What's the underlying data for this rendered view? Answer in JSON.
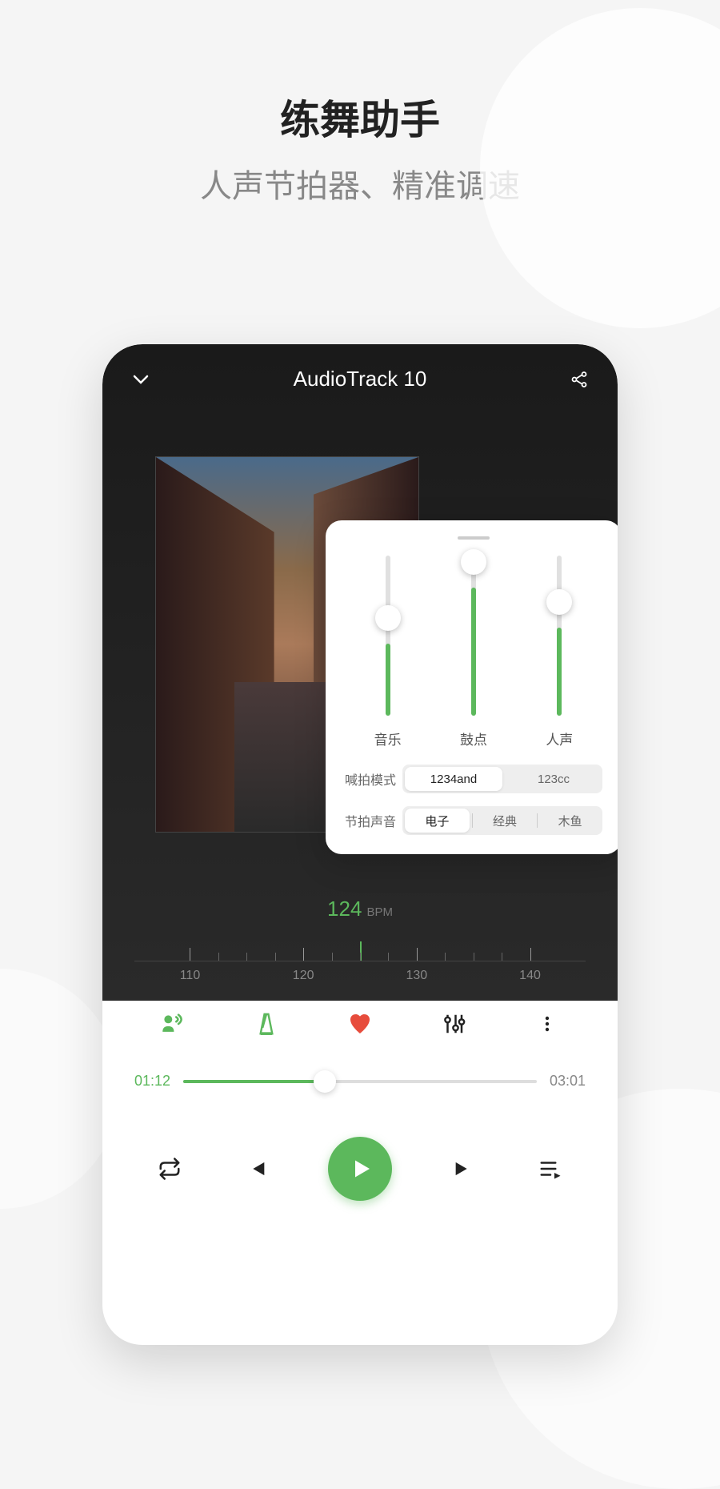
{
  "hero": {
    "title": "练舞助手",
    "subtitle": "人声节拍器、精准调速"
  },
  "header": {
    "track_title": "AudioTrack 10"
  },
  "bpm": {
    "value": "124",
    "unit": "BPM"
  },
  "ruler": {
    "ticks": [
      "110",
      "120",
      "130",
      "140"
    ]
  },
  "panel": {
    "sliders": [
      {
        "label": "音乐",
        "pct": 45
      },
      {
        "label": "鼓点",
        "pct": 80
      },
      {
        "label": "人声",
        "pct": 55
      }
    ],
    "mode_label": "喊拍模式",
    "mode_options": [
      "1234and",
      "123cc"
    ],
    "sound_label": "节拍声音",
    "sound_options": [
      "电子",
      "经典",
      "木鱼"
    ]
  },
  "progress": {
    "current": "01:12",
    "total": "03:01",
    "pct": 40
  }
}
